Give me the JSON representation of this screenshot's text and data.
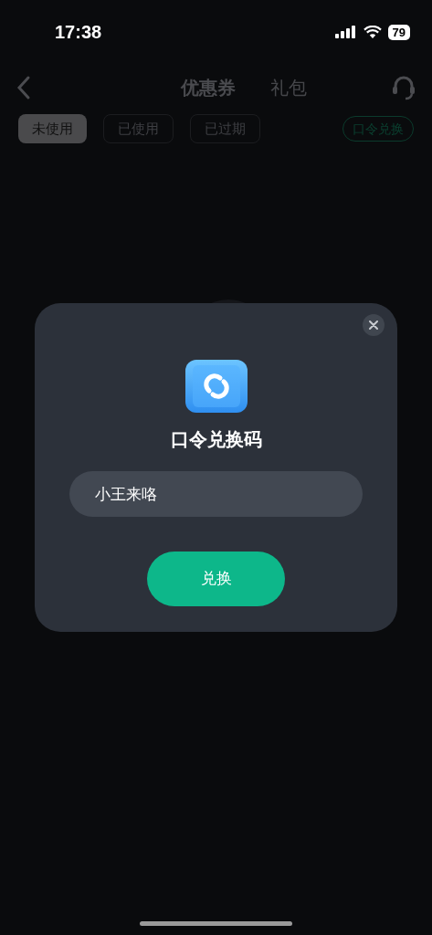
{
  "status_bar": {
    "time": "17:38",
    "battery": "79"
  },
  "nav": {
    "tabs": [
      {
        "label": "优惠券",
        "selected": true
      },
      {
        "label": "礼包",
        "selected": false
      }
    ]
  },
  "filters": [
    {
      "label": "未使用",
      "selected": true
    },
    {
      "label": "已使用",
      "selected": false
    },
    {
      "label": "已过期",
      "selected": false
    }
  ],
  "redeem_link": "口令兑换",
  "dialog": {
    "title": "口令兑换码",
    "input": {
      "value": "小王来咯"
    },
    "button": "兑换"
  }
}
